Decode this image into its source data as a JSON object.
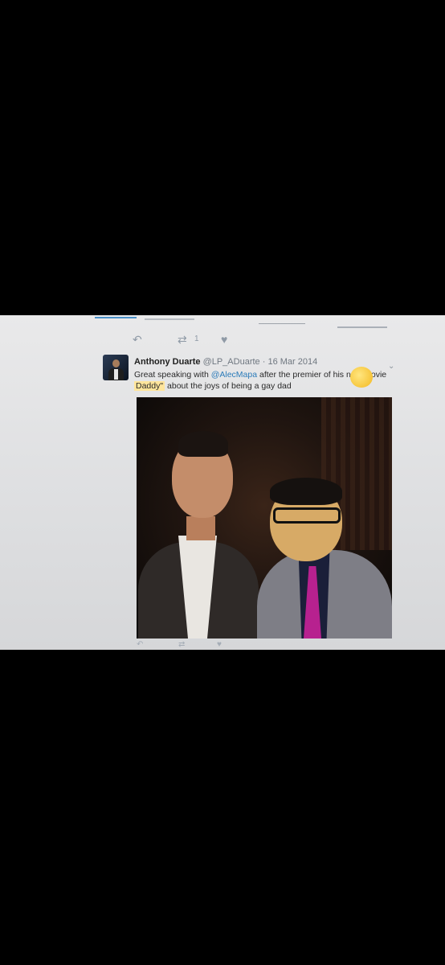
{
  "previous_tweet_actions": {
    "reply_icon": "reply-icon",
    "retweet_icon": "retweet-icon",
    "retweet_count": "1",
    "like_icon": "heart-icon"
  },
  "tweet": {
    "author_name": "Anthony Duarte",
    "handle": "@LP_ADuarte",
    "separator": "·",
    "date": "16 Mar 2014",
    "text_part1": "Great speaking with ",
    "mention": "@AlecMapa",
    "text_part2": " after the premier of his new movie ",
    "highlight": "Daddy\"",
    "text_part3": " about the joys of being a gay dad",
    "dropdown_icon": "chevron-down-icon"
  },
  "colors": {
    "mention": "#2b7bb9",
    "highlight": "#ffe59c",
    "background": "#000000",
    "screen": "#e3e4e6"
  }
}
